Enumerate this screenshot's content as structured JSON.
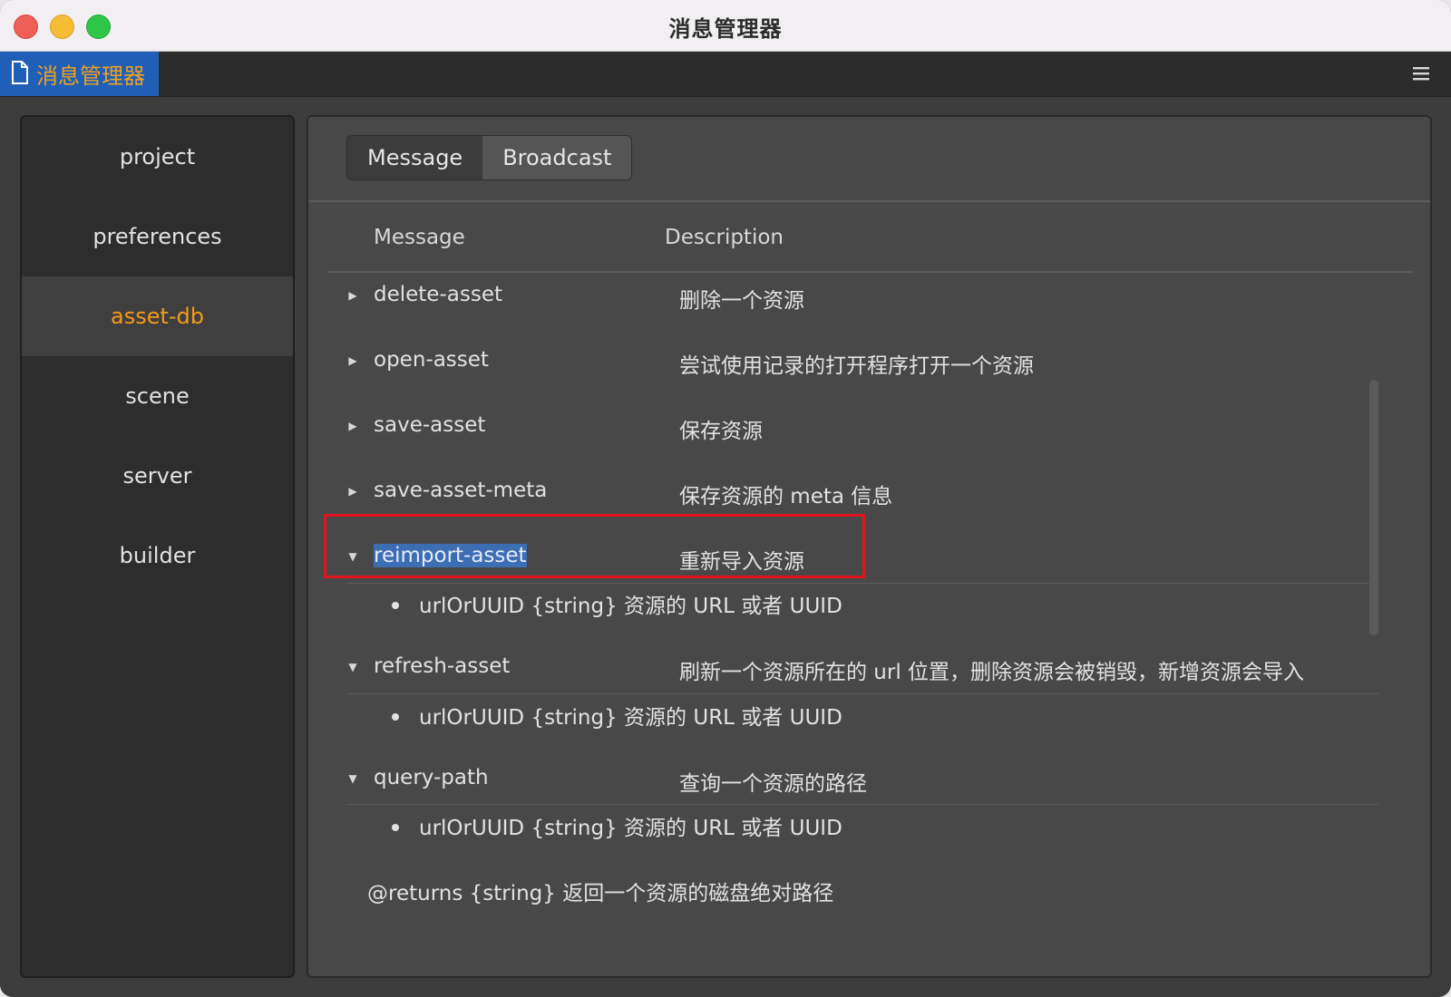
{
  "window": {
    "title": "消息管理器"
  },
  "panel_tab": {
    "label": "消息管理器",
    "icon": "document-icon"
  },
  "menu": {
    "icon": "hamburger-menu-icon",
    "glyph": "≡"
  },
  "sidebar": {
    "items": [
      {
        "label": "project"
      },
      {
        "label": "preferences"
      },
      {
        "label": "asset-db"
      },
      {
        "label": "scene"
      },
      {
        "label": "server"
      },
      {
        "label": "builder"
      }
    ],
    "selected": "asset-db"
  },
  "tabs": {
    "message_label": "Message",
    "broadcast_label": "Broadcast",
    "selected": "Message"
  },
  "table": {
    "col_message": "Message",
    "col_description": "Description",
    "rows": [
      {
        "name": "delete-asset",
        "desc": "删除一个资源",
        "expanded": false
      },
      {
        "name": "open-asset",
        "desc": "尝试使用记录的打开程序打开一个资源",
        "expanded": false
      },
      {
        "name": "save-asset",
        "desc": "保存资源",
        "expanded": false
      },
      {
        "name": "save-asset-meta",
        "desc": "保存资源的 meta 信息",
        "expanded": false
      },
      {
        "name": "reimport-asset",
        "desc": "重新导入资源",
        "expanded": true,
        "param": "urlOrUUID {string} 资源的 URL 或者 UUID"
      },
      {
        "name": "refresh-asset",
        "desc": "刷新一个资源所在的 url 位置，删除资源会被销毁，新增资源会导入",
        "expanded": true,
        "param": "urlOrUUID {string} 资源的 URL 或者 UUID"
      },
      {
        "name": "query-path",
        "desc": "查询一个资源的路径",
        "expanded": true,
        "param": "urlOrUUID {string} 资源的 URL 或者 UUID"
      }
    ],
    "returns": "@returns {string} 返回一个资源的磁盘绝对路径"
  },
  "colors": {
    "accent_orange": "#f29b1a",
    "selection_blue": "#3d6db3",
    "annotation_red": "#e0141c"
  }
}
